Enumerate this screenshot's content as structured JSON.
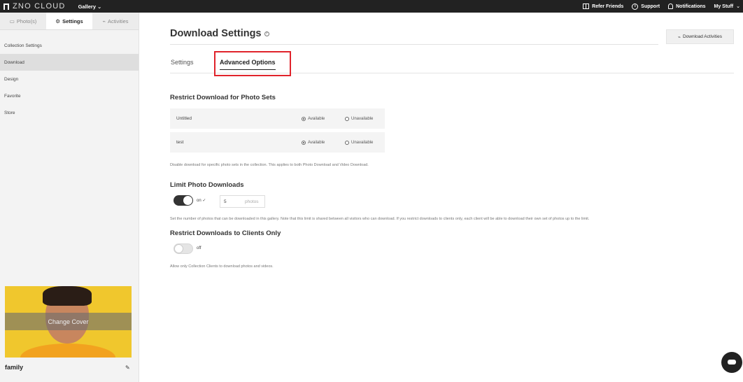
{
  "topbar": {
    "logo_text": "ZNO CLOUD",
    "gallery_label": "Gallery",
    "nav": {
      "refer": "Refer Friends",
      "support": "Support",
      "notifications": "Notifications",
      "my_stuff": "My Stuff"
    }
  },
  "sidebar": {
    "tabs": [
      {
        "label": "Photo(s)",
        "icon": "photo-icon"
      },
      {
        "label": "Settings",
        "icon": "gear-icon",
        "active": true
      },
      {
        "label": "Activities",
        "icon": "rss-icon"
      }
    ],
    "items": [
      {
        "label": "Collection Settings"
      },
      {
        "label": "Download",
        "active": true
      },
      {
        "label": "Design"
      },
      {
        "label": "Favorite"
      },
      {
        "label": "Store"
      }
    ],
    "cover_label": "Change Cover",
    "collection_name": "family"
  },
  "main": {
    "title": "Download Settings",
    "activities_button": "Download Activities",
    "tabs": [
      {
        "label": "Settings"
      },
      {
        "label": "Advanced Options",
        "active": true
      }
    ],
    "restrict_sets": {
      "title": "Restrict Download for Photo Sets",
      "rows": [
        {
          "name": "Untitled",
          "available": "Available",
          "unavailable": "Unavailable",
          "selected": "Available"
        },
        {
          "name": "test",
          "available": "Available",
          "unavailable": "Unavailable",
          "selected": "Available"
        }
      ],
      "help": "Disable download for specific photo sets in the collection. This applies to both Photo Download and Video Download."
    },
    "limit": {
      "title": "Limit Photo Downloads",
      "toggle_text": "on",
      "toggle_on": true,
      "value": "5",
      "unit": "photos",
      "help": "Set the number of photos that can be downloaded in this gallery. Note that this limit is shared between all visitors who can download. If you restrict downloads to clients only, each client will be able to download their own set of photos up to the limit."
    },
    "clients": {
      "title": "Restrict Downloads to Clients Only",
      "toggle_text": "off",
      "toggle_on": false,
      "help": "Allow only Collection Clients to download photos and videos."
    }
  },
  "colors": {
    "highlight": "#e0232b",
    "topbar": "#222222",
    "cover_background": "#f0c72d"
  }
}
